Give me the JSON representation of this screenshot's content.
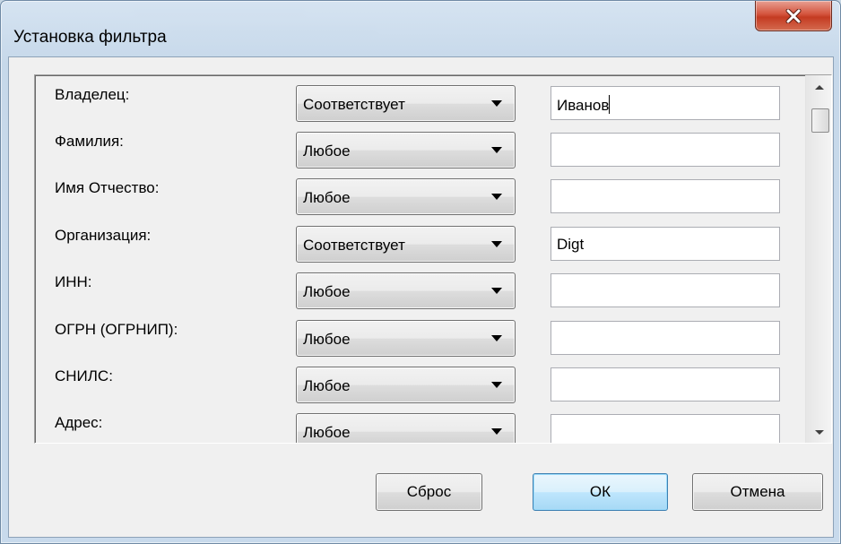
{
  "window": {
    "title": "Установка фильтра",
    "close_icon": "close-icon"
  },
  "filters": [
    {
      "label": "Владелец:",
      "condition": "Соответствует",
      "value": "Иванов"
    },
    {
      "label": "Фамилия:",
      "condition": "Любое",
      "value": ""
    },
    {
      "label": "Имя Отчество:",
      "condition": "Любое",
      "value": ""
    },
    {
      "label": "Организация:",
      "condition": "Соответствует",
      "value": "Digt"
    },
    {
      "label": "ИНН:",
      "condition": "Любое",
      "value": ""
    },
    {
      "label": "ОГРН (ОГРНИП):",
      "condition": "Любое",
      "value": ""
    },
    {
      "label": "СНИЛС:",
      "condition": "Любое",
      "value": ""
    },
    {
      "label": "Адрес:",
      "condition": "Любое",
      "value": ""
    }
  ],
  "buttons": {
    "reset": "Сброс",
    "ok": "ОК",
    "cancel": "Отмена"
  },
  "colors": {
    "close_button": "#c43b22",
    "default_button_border": "#3c7fb1"
  }
}
